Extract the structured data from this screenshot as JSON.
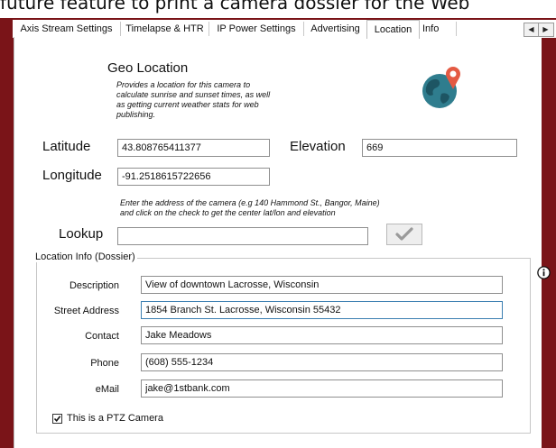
{
  "background_text": "future feature to print a camera dossier for the Web",
  "tabs": [
    {
      "label": "Axis Stream Settings"
    },
    {
      "label": "Timelapse & HTR"
    },
    {
      "label": "IP Power Settings"
    },
    {
      "label": "Advertising"
    },
    {
      "label": "Location"
    },
    {
      "label": "Info"
    }
  ],
  "active_tab": "Location",
  "geo": {
    "title": "Geo Location",
    "description": "Provides a location for this camera to calculate sunrise and sunset times, as well as getting current weather stats for web publishing.",
    "desc_lines": [
      "Provides a location for this camera to",
      "calculate sunrise and sunset times, as well",
      "as getting current weather stats for web",
      "publishing."
    ]
  },
  "latitude": {
    "label": "Latitude",
    "value": "43.808765411377"
  },
  "elevation": {
    "label": "Elevation",
    "value": "669"
  },
  "longitude": {
    "label": "Longitude",
    "value": "-91.2518615722656"
  },
  "address_hint_lines": [
    "Enter the address of the camera (e.g 140 Hammond St., Bangor, Maine)",
    "and click on the check to get the center lat/lon and elevation"
  ],
  "lookup": {
    "label": "Lookup",
    "value": ""
  },
  "dossier": {
    "legend": "Location Info (Dossier)",
    "description": {
      "label": "Description",
      "value": "View of downtown Lacrosse, Wisconsin"
    },
    "street": {
      "label": "Street Address",
      "value": "1854 Branch St. Lacrosse, Wisconsin 55432"
    },
    "contact": {
      "label": "Contact",
      "value": "Jake Meadows"
    },
    "phone": {
      "label": "Phone",
      "value": "(608) 555-1234"
    },
    "email": {
      "label": "eMail",
      "value": "jake@1stbank.com"
    },
    "ptz": {
      "label": "This is a PTZ Camera",
      "checked": true
    }
  },
  "icons": [
    "globe-pin-icon",
    "checkmark-icon",
    "info-icon",
    "scroll-left-icon",
    "scroll-right-icon"
  ],
  "colors": {
    "frame": "#7a1418",
    "globe": "#2f7d8e",
    "pin": "#e45a43",
    "focus_border": "#3c7fb1"
  }
}
